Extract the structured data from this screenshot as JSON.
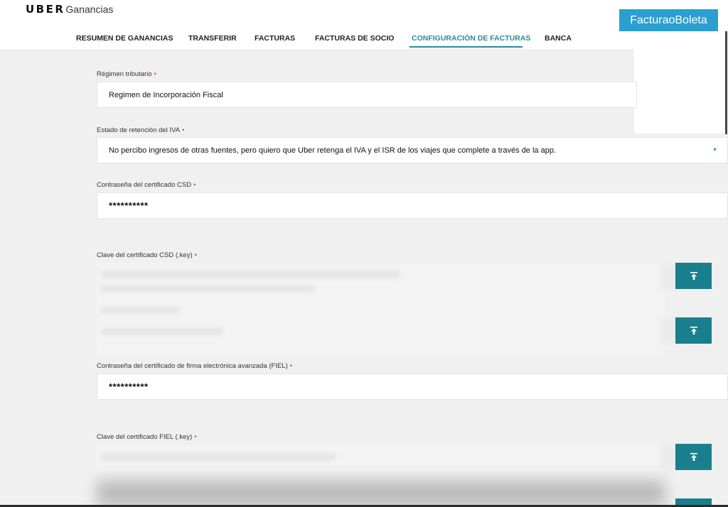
{
  "brand": {
    "logo": "UBER",
    "product": "Ganancias"
  },
  "nav": {
    "items": [
      {
        "label": "RESUMEN DE GANANCIAS"
      },
      {
        "label": "TRANSFERIR"
      },
      {
        "label": "FACTURAS"
      },
      {
        "label": "FACTURAS DE SOCIO"
      },
      {
        "label": "CONFIGURACIÓN DE FACTURAS",
        "active": true
      },
      {
        "label": "BANCA"
      }
    ]
  },
  "badge": {
    "text": "FacturaoBoleta"
  },
  "form": {
    "required_mark": "•",
    "regimen": {
      "label": "Régimen tributario",
      "value": "Regimen de Incorporación Fiscal"
    },
    "retencion": {
      "label": "Estado de retención del IVA",
      "value": "No percibo ingresos de otras fuentes, pero quiero que Uber retenga el IVA y el ISR de los viajes que complete a través de la app.",
      "caret": "▼"
    },
    "csd_password": {
      "label": "Contraseña del certificado CSD",
      "value": "**********"
    },
    "csd_key": {
      "label": "Clave del certificado CSD (.key)"
    },
    "fiel_password": {
      "label": "Contraseña del certificado de firma electrónica avanzada (FIEL)",
      "value": "**********"
    },
    "fiel_key": {
      "label": "Clave del certificado FIEL (.key)"
    }
  },
  "colors": {
    "accent": "#2a8a99",
    "upload_button": "#1a7f8c",
    "badge": "#2a9fd0",
    "required": "#d0453c"
  },
  "icons": {
    "upload": "upload-arrow-icon"
  }
}
